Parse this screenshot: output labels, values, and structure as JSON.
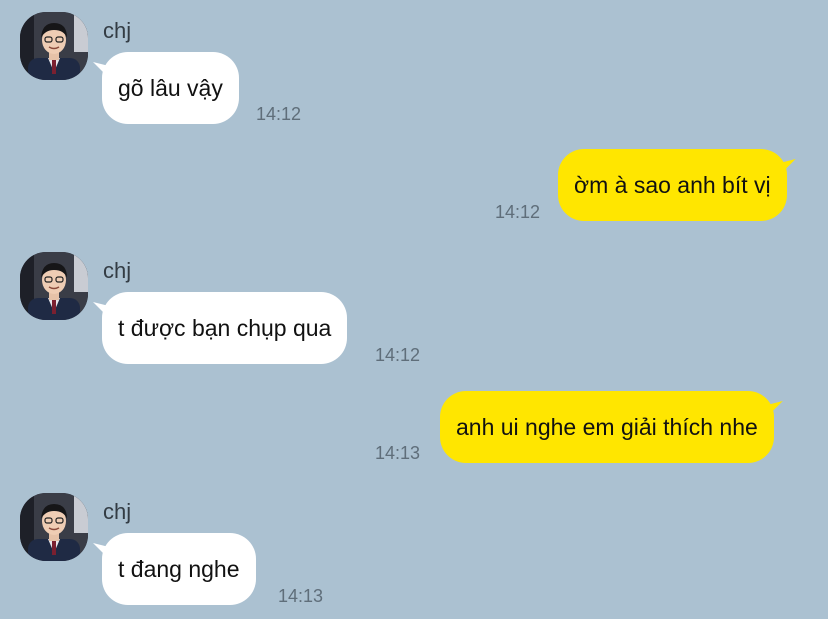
{
  "messages": [
    {
      "direction": "in",
      "sender": "chj",
      "text": "gõ lâu vậy",
      "time": "14:12"
    },
    {
      "direction": "out",
      "text": "ờm à sao anh bít vị",
      "time": "14:12"
    },
    {
      "direction": "in",
      "sender": "chj",
      "text": "t được bạn chụp qua",
      "time": "14:12"
    },
    {
      "direction": "out",
      "text": "anh ui nghe em giải thích nhe",
      "time": "14:13"
    },
    {
      "direction": "in",
      "sender": "chj",
      "text": "t đang nghe",
      "time": "14:13"
    }
  ],
  "colors": {
    "background": "#abc1d1",
    "incoming_bubble": "#ffffff",
    "outgoing_bubble": "#ffe600",
    "timestamp": "#5f6e7a"
  }
}
